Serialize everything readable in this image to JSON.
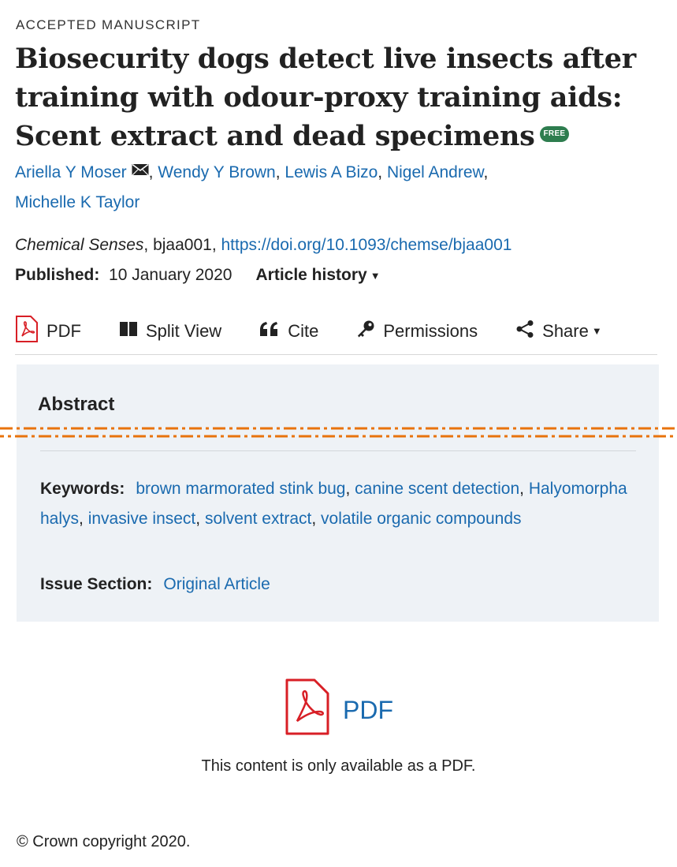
{
  "header": {
    "status_label": "ACCEPTED MANUSCRIPT",
    "title": "Biosecurity dogs detect live insects after training with odour-proxy training aids: Scent extract and dead specimens",
    "free_badge": "FREE"
  },
  "authors": [
    {
      "name": "Ariella Y Moser",
      "corresponding": true
    },
    {
      "name": "Wendy Y Brown"
    },
    {
      "name": "Lewis A Bizo"
    },
    {
      "name": "Nigel Andrew"
    },
    {
      "name": "Michelle K Taylor"
    }
  ],
  "citation": {
    "journal": "Chemical Senses",
    "article_id": ", bjaa001, ",
    "doi": "https://doi.org/10.1093/chemse/bjaa001"
  },
  "published": {
    "label": "Published:",
    "date": "10 January 2020",
    "history_label": "Article history"
  },
  "toolbar": {
    "pdf": "PDF",
    "split_view": "Split View",
    "cite": "Cite",
    "permissions": "Permissions",
    "share": "Share"
  },
  "abstract": {
    "title": "Abstract",
    "keywords_label": "Keywords:",
    "keywords": [
      "brown marmorated stink bug",
      "canine scent detection",
      "Ha­lyomorpha halys",
      "invasive insect",
      "solvent extract",
      "volatile organic com­pounds"
    ],
    "issue_section_label": "Issue Section:",
    "issue_section": "Original Article"
  },
  "pdf_block": {
    "link_text": "PDF",
    "note": "This content is only available as a PDF."
  },
  "footer": {
    "copyright": "© Crown copyright 2020."
  },
  "colors": {
    "link": "#1a6aaf",
    "free_badge": "#2e7d4f",
    "pdf_red": "#d81f26",
    "dash_orange": "#e8730c",
    "abstract_bg": "#eef2f6"
  }
}
